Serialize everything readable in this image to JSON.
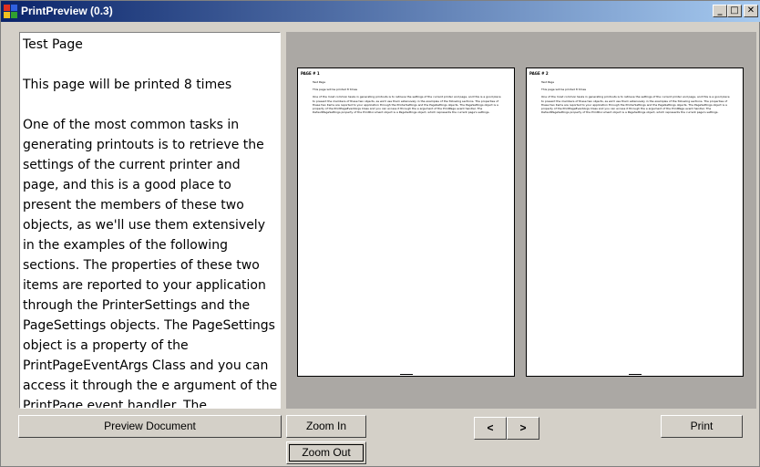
{
  "window": {
    "title": "PrintPreview (0.3)",
    "controls": {
      "minimize": "_",
      "maximize": "□",
      "close": "✕"
    }
  },
  "document": {
    "paragraphs": [
      "Test Page",
      "This page will be printed 8 times",
      "One of the most common tasks in generating printouts is to retrieve the settings of the current printer and page, and this is a good place to present the members of these two objects, as we'll use them extensively in the examples of the following sections. The properties of these two items are reported to your application through the PrinterSettings and the PageSettings objects. The PageSettings object is a property of the PrintPageEventArgs Class and you can access it through the e argument of the PrintPage event handler. The DefaultPageSettings property of the"
    ]
  },
  "preview": {
    "pages": [
      {
        "header": "PAGE # 1",
        "paragraphs": [
          "Test Page",
          "This page will be printed 8 times",
          "One of the most common tasks in generating printouts is to retrieve the settings of the current printer and page, and this is a good place to present the members of these two objects, as we'll use them extensively in the examples of the following sections. The properties of these two items are reported to your application through the PrinterSettings and the PageSettings objects. The PageSettings object is a property of the PrintPageEventArgs Class and you can access it through the e argument of the PrintPage event handler. The DefaultPageSettings property of the PrintDocument object is a PageSettings object, which represents the current page's settings."
        ]
      },
      {
        "header": "PAGE # 2",
        "paragraphs": [
          "Test Page",
          "This page will be printed 8 times",
          "One of the most common tasks in generating printouts is to retrieve the settings of the current printer and page, and this is a good place to present the members of these two objects, as we'll use them extensively in the examples of the following sections. The properties of these two items are reported to your application through the PrinterSettings and the PageSettings objects. The PageSettings object is a property of the PrintPageEventArgs Class and you can access it through the e argument of the PrintPage event handler. The DefaultPageSettings property of the PrintDocument object is a PageSettings object, which represents the current page's settings."
        ]
      }
    ]
  },
  "buttons": {
    "preview_document": "Preview Document",
    "zoom_in": "Zoom In",
    "zoom_out": "Zoom Out",
    "prev": "<",
    "next": ">",
    "print": "Print"
  },
  "colors": {
    "titlebar_start": "#0a246a",
    "titlebar_end": "#a6caf0",
    "window_bg": "#d4d0c8",
    "preview_bg": "#aba8a4"
  }
}
